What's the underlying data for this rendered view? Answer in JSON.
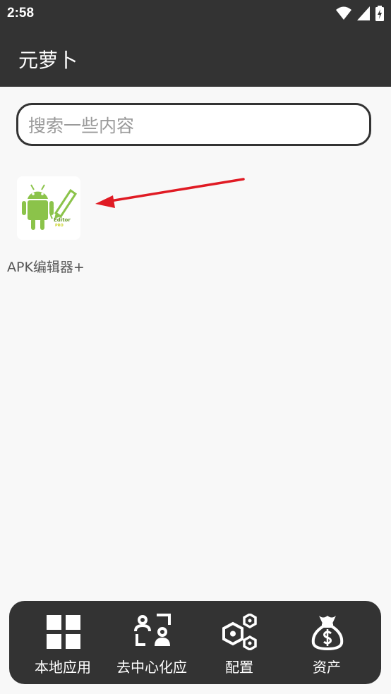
{
  "status_bar": {
    "time": "2:58"
  },
  "app_bar": {
    "title": "元萝卜"
  },
  "search": {
    "placeholder": "搜索一些内容",
    "value": ""
  },
  "apps": [
    {
      "label": "APK编辑器+",
      "icon_text": "Editor",
      "icon_subtext": "PRO"
    }
  ],
  "bottom_nav": {
    "items": [
      {
        "label": "本地应用",
        "icon": "grid-icon"
      },
      {
        "label": "去中心化应",
        "icon": "scan-user-icon"
      },
      {
        "label": "配置",
        "icon": "hex-nuts-icon"
      },
      {
        "label": "资产",
        "icon": "money-bag-icon"
      }
    ]
  },
  "colors": {
    "bar": "#333333",
    "background": "#f8f8f8",
    "android_green": "#8bc34a",
    "annotation_arrow": "#e01b24"
  }
}
